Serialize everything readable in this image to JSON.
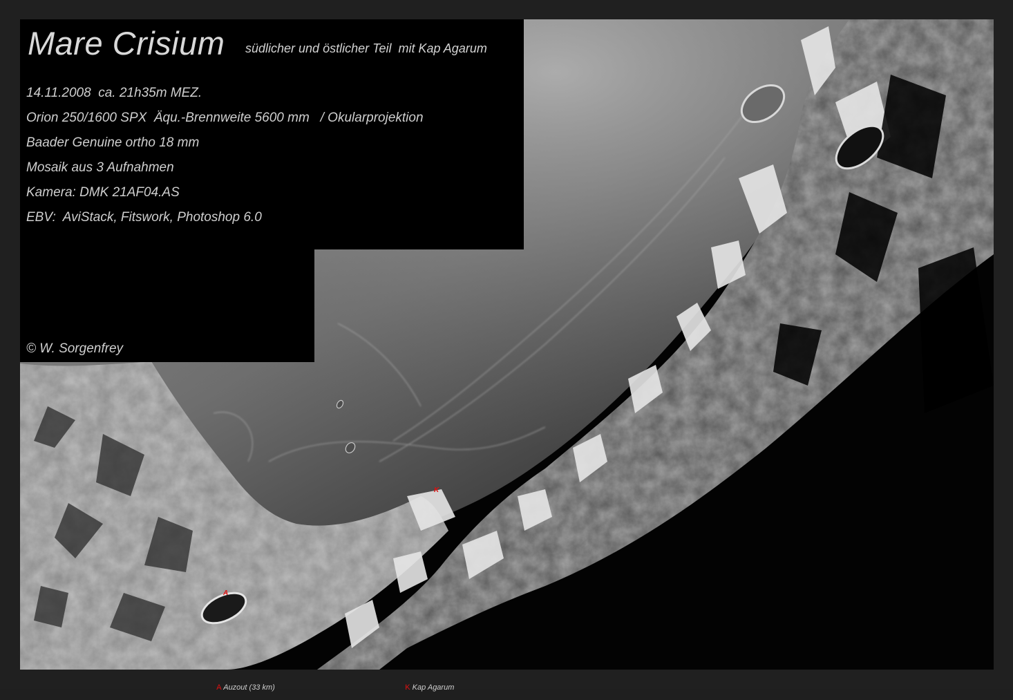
{
  "title": "Mare Crisium",
  "subtitle": "südlicher und östlicher Teil  mit Kap Agarum",
  "info_lines": [
    "14.11.2008  ca. 21h35m MEZ.",
    "Orion 250/1600 SPX  Äqu.-Brennweite 5600 mm   / Okularprojektion",
    "Baader Genuine ortho 18 mm",
    "Mosaik aus 3 Aufnahmen",
    "Kamera: DMK 21AF04.AS",
    "EBV:  AviStack, Fitswork, Photoshop 6.0"
  ],
  "copyright": "© W. Sorgenfrey",
  "markers": {
    "a": "A",
    "k": "K"
  },
  "legend": {
    "a_key": "A",
    "a_label": " Auzout (33 km)",
    "k_key": "K",
    "k_label": " Kap Agarum"
  },
  "colors": {
    "background": "#202020",
    "marker": "#e01010",
    "text": "#cfcfcf"
  }
}
